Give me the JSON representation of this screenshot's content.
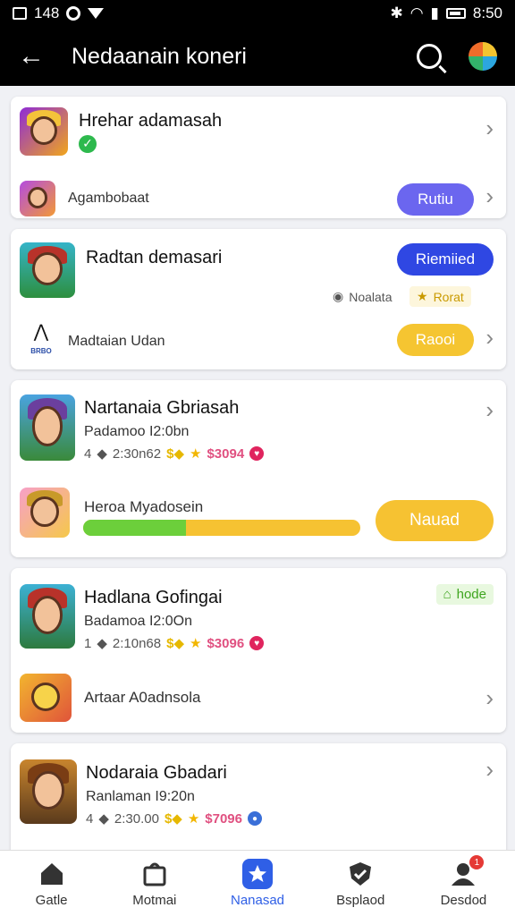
{
  "status_bar": {
    "left_text": "148",
    "time": "8:50"
  },
  "app_bar": {
    "title": "Nedaanain koneri"
  },
  "cards": {
    "c1": {
      "title": "Hrehar adamasah",
      "sub_label": "Agambobaat",
      "button": "Rutiu",
      "button_color": "#6b66ef"
    },
    "c2": {
      "title": "Radtan demasari",
      "top_button": "Riemiied",
      "top_button_color": "#2f47e3",
      "tag1": "Noalata",
      "tag2": "Rorat",
      "sub_label": "Madtaian Udan",
      "logo_text": "BRBO",
      "button": "Raooi",
      "button_color": "#f5c531"
    },
    "c3": {
      "title": "Nartanaia Gbriasah",
      "subtitle": "Padamoo I2:0bn",
      "meta_num": "4",
      "meta_time": "2:30n62",
      "meta_price": "$3094",
      "sub_label": "Heroa Myadosein",
      "button": "Nauad",
      "button_color": "#f6c232",
      "progress": 0.37
    },
    "c4": {
      "title": "Hadlana Gofingai",
      "subtitle": "Badamoa I2:0On",
      "meta_num": "1",
      "meta_time": "2:10n68",
      "meta_price": "$3096",
      "tag": "hode",
      "sub_label": "Artaar A0adnsola"
    },
    "c5": {
      "title": "Nodaraia Gbadari",
      "subtitle": "Ranlaman I9:20n",
      "meta_num": "4",
      "meta_time": "2:30.00",
      "meta_price": "$7096"
    }
  },
  "bottom_nav": [
    {
      "label": "Gatle",
      "icon": "home-icon"
    },
    {
      "label": "Motmai",
      "icon": "bag-icon"
    },
    {
      "label": "Nanasad",
      "icon": "star-icon"
    },
    {
      "label": "Bsplaod",
      "icon": "shield-check-icon"
    },
    {
      "label": "Desdod",
      "icon": "profile-icon",
      "badge": "1"
    }
  ],
  "colors": {
    "accent": "#2f5fe6",
    "header_bg": "#000000",
    "background": "#f0f1f5"
  }
}
